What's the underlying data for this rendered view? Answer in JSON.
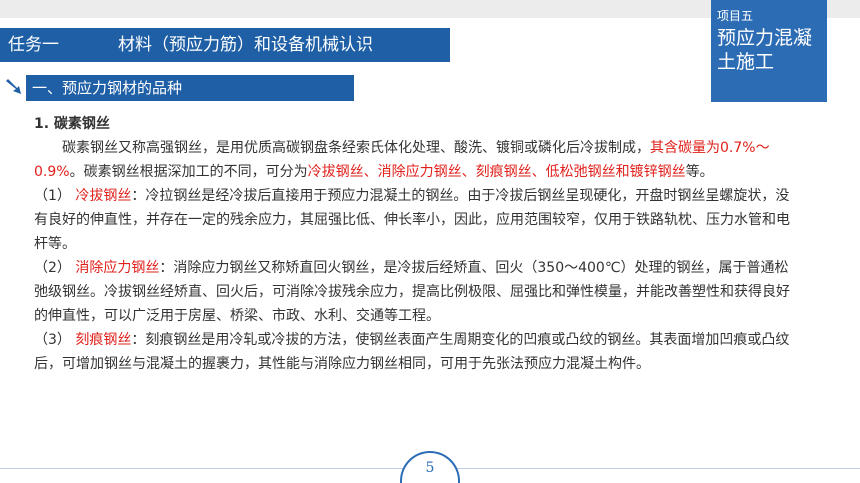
{
  "header": {
    "task_label": "任务一",
    "task_title": "材料（预应力筋）和设备机械认识",
    "project_label": "项目五",
    "project_name": "预应力混凝土施工"
  },
  "section": {
    "title": "一、预应力钢材的品种"
  },
  "content": {
    "heading": "1. 碳素钢丝",
    "p1_a": "碳素钢丝又称高强钢丝，是用优质高碳钢盘条经索氏体化处理、酸洗、镀铜或磷化后冷拔制成，",
    "p1_red1": "其含碳量为0.7%～0.9%",
    "p1_b": "。碳素钢丝根据深加工的不同，可分为",
    "p1_red2": "冷拔钢丝、消除应力钢丝、刻痕钢丝、低松弛钢丝和镀锌钢丝",
    "p1_c": "等。",
    "p2_num": "（1）",
    "p2_red": "冷拔钢丝",
    "p2_text": "：冷拉钢丝是经冷拔后直接用于预应力混凝土的钢丝。由于冷拔后钢丝呈现硬化，开盘时钢丝呈螺旋状，没有良好的伸直性，并存在一定的残余应力，其屈强比低、伸长率小，因此，应用范围较窄，仅用于铁路轨枕、压力水管和电杆等。",
    "p3_num": "（2）",
    "p3_red": "消除应力钢丝",
    "p3_text": "：消除应力钢丝又称矫直回火钢丝，是冷拔后经矫直、回火（350～400℃）处理的钢丝，属于普通松弛级钢丝。冷拔钢丝经矫直、回火后，可消除冷拔残余应力，提高比例极限、屈强比和弹性模量，并能改善塑性和获得良好的伸直性，可以广泛用于房屋、桥梁、市政、水利、交通等工程。",
    "p4_num": "（3）",
    "p4_red": "刻痕钢丝",
    "p4_text": "：刻痕钢丝是用冷轧或冷拔的方法，使钢丝表面产生周期变化的凹痕或凸纹的钢丝。其表面增加凹痕或凸纹后，可增加钢丝与混凝土的握裹力，其性能与消除应力钢丝相同，可用于先张法预应力混凝土构件。"
  },
  "footer": {
    "page_number": "5"
  },
  "icons": {
    "section_arrow": "arrow-down-right-icon"
  },
  "colors": {
    "primary_blue": "#1f5fa6",
    "corner_blue": "#2c6cb5",
    "highlight_red": "#e0201b"
  }
}
